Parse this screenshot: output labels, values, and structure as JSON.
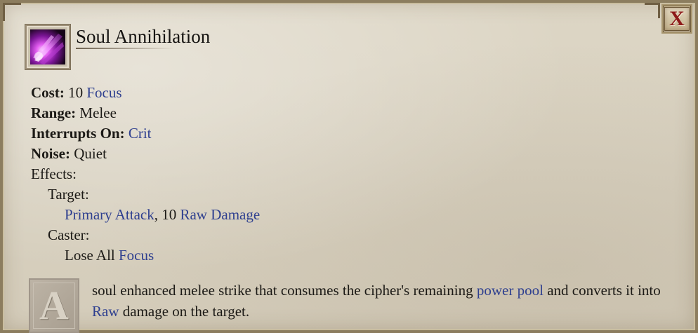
{
  "ability": {
    "name": "Soul Annihilation",
    "icon": "soul-annihilation-icon"
  },
  "close_button": {
    "label": "X"
  },
  "stats": {
    "cost": {
      "label": "Cost:",
      "amount": "10",
      "resource": "Focus"
    },
    "range": {
      "label": "Range:",
      "value": "Melee"
    },
    "interrupts": {
      "label": "Interrupts On:",
      "value": "Crit"
    },
    "noise": {
      "label": "Noise:",
      "value": "Quiet"
    }
  },
  "effects": {
    "label": "Effects:",
    "target": {
      "label": "Target:",
      "attack": "Primary Attack",
      "separator": ", 10 ",
      "damage": "Raw Damage"
    },
    "caster": {
      "label": "Caster:",
      "prefix": "Lose All ",
      "resource": "Focus"
    }
  },
  "description": {
    "drop_cap": "A",
    "part1": " soul enhanced melee strike that consumes the cipher's remaining ",
    "link1": "power pool",
    "part2": " and converts it into ",
    "link2": "Raw",
    "part3": " damage on the target."
  },
  "colors": {
    "keyword": "#2e3f8f",
    "parchment": "#d8d1c0",
    "close_x": "#8e1a1a"
  }
}
